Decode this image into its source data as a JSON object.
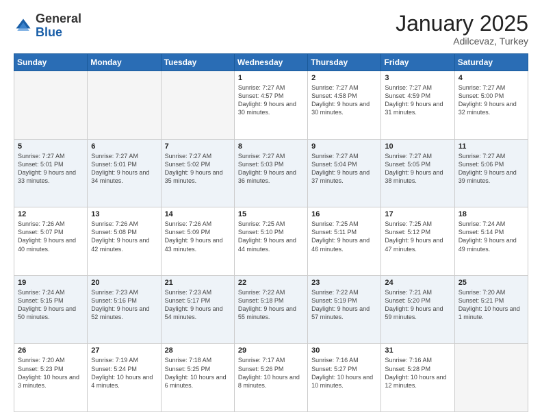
{
  "header": {
    "logo_general": "General",
    "logo_blue": "Blue",
    "month_year": "January 2025",
    "location": "Adilcevaz, Turkey"
  },
  "days_of_week": [
    "Sunday",
    "Monday",
    "Tuesday",
    "Wednesday",
    "Thursday",
    "Friday",
    "Saturday"
  ],
  "weeks": [
    {
      "cells": [
        {
          "day": "",
          "empty": true
        },
        {
          "day": "",
          "empty": true
        },
        {
          "day": "",
          "empty": true
        },
        {
          "day": "1",
          "sunrise": "7:27 AM",
          "sunset": "4:57 PM",
          "daylight": "9 hours and 30 minutes."
        },
        {
          "day": "2",
          "sunrise": "7:27 AM",
          "sunset": "4:58 PM",
          "daylight": "9 hours and 30 minutes."
        },
        {
          "day": "3",
          "sunrise": "7:27 AM",
          "sunset": "4:59 PM",
          "daylight": "9 hours and 31 minutes."
        },
        {
          "day": "4",
          "sunrise": "7:27 AM",
          "sunset": "5:00 PM",
          "daylight": "9 hours and 32 minutes."
        }
      ]
    },
    {
      "cells": [
        {
          "day": "5",
          "sunrise": "7:27 AM",
          "sunset": "5:01 PM",
          "daylight": "9 hours and 33 minutes."
        },
        {
          "day": "6",
          "sunrise": "7:27 AM",
          "sunset": "5:01 PM",
          "daylight": "9 hours and 34 minutes."
        },
        {
          "day": "7",
          "sunrise": "7:27 AM",
          "sunset": "5:02 PM",
          "daylight": "9 hours and 35 minutes."
        },
        {
          "day": "8",
          "sunrise": "7:27 AM",
          "sunset": "5:03 PM",
          "daylight": "9 hours and 36 minutes."
        },
        {
          "day": "9",
          "sunrise": "7:27 AM",
          "sunset": "5:04 PM",
          "daylight": "9 hours and 37 minutes."
        },
        {
          "day": "10",
          "sunrise": "7:27 AM",
          "sunset": "5:05 PM",
          "daylight": "9 hours and 38 minutes."
        },
        {
          "day": "11",
          "sunrise": "7:27 AM",
          "sunset": "5:06 PM",
          "daylight": "9 hours and 39 minutes."
        }
      ]
    },
    {
      "cells": [
        {
          "day": "12",
          "sunrise": "7:26 AM",
          "sunset": "5:07 PM",
          "daylight": "9 hours and 40 minutes."
        },
        {
          "day": "13",
          "sunrise": "7:26 AM",
          "sunset": "5:08 PM",
          "daylight": "9 hours and 42 minutes."
        },
        {
          "day": "14",
          "sunrise": "7:26 AM",
          "sunset": "5:09 PM",
          "daylight": "9 hours and 43 minutes."
        },
        {
          "day": "15",
          "sunrise": "7:25 AM",
          "sunset": "5:10 PM",
          "daylight": "9 hours and 44 minutes."
        },
        {
          "day": "16",
          "sunrise": "7:25 AM",
          "sunset": "5:11 PM",
          "daylight": "9 hours and 46 minutes."
        },
        {
          "day": "17",
          "sunrise": "7:25 AM",
          "sunset": "5:12 PM",
          "daylight": "9 hours and 47 minutes."
        },
        {
          "day": "18",
          "sunrise": "7:24 AM",
          "sunset": "5:14 PM",
          "daylight": "9 hours and 49 minutes."
        }
      ]
    },
    {
      "cells": [
        {
          "day": "19",
          "sunrise": "7:24 AM",
          "sunset": "5:15 PM",
          "daylight": "9 hours and 50 minutes."
        },
        {
          "day": "20",
          "sunrise": "7:23 AM",
          "sunset": "5:16 PM",
          "daylight": "9 hours and 52 minutes."
        },
        {
          "day": "21",
          "sunrise": "7:23 AM",
          "sunset": "5:17 PM",
          "daylight": "9 hours and 54 minutes."
        },
        {
          "day": "22",
          "sunrise": "7:22 AM",
          "sunset": "5:18 PM",
          "daylight": "9 hours and 55 minutes."
        },
        {
          "day": "23",
          "sunrise": "7:22 AM",
          "sunset": "5:19 PM",
          "daylight": "9 hours and 57 minutes."
        },
        {
          "day": "24",
          "sunrise": "7:21 AM",
          "sunset": "5:20 PM",
          "daylight": "9 hours and 59 minutes."
        },
        {
          "day": "25",
          "sunrise": "7:20 AM",
          "sunset": "5:21 PM",
          "daylight": "10 hours and 1 minute."
        }
      ]
    },
    {
      "cells": [
        {
          "day": "26",
          "sunrise": "7:20 AM",
          "sunset": "5:23 PM",
          "daylight": "10 hours and 3 minutes."
        },
        {
          "day": "27",
          "sunrise": "7:19 AM",
          "sunset": "5:24 PM",
          "daylight": "10 hours and 4 minutes."
        },
        {
          "day": "28",
          "sunrise": "7:18 AM",
          "sunset": "5:25 PM",
          "daylight": "10 hours and 6 minutes."
        },
        {
          "day": "29",
          "sunrise": "7:17 AM",
          "sunset": "5:26 PM",
          "daylight": "10 hours and 8 minutes."
        },
        {
          "day": "30",
          "sunrise": "7:16 AM",
          "sunset": "5:27 PM",
          "daylight": "10 hours and 10 minutes."
        },
        {
          "day": "31",
          "sunrise": "7:16 AM",
          "sunset": "5:28 PM",
          "daylight": "10 hours and 12 minutes."
        },
        {
          "day": "",
          "empty": true
        }
      ]
    }
  ],
  "labels": {
    "sunrise": "Sunrise:",
    "sunset": "Sunset:",
    "daylight": "Daylight:"
  }
}
